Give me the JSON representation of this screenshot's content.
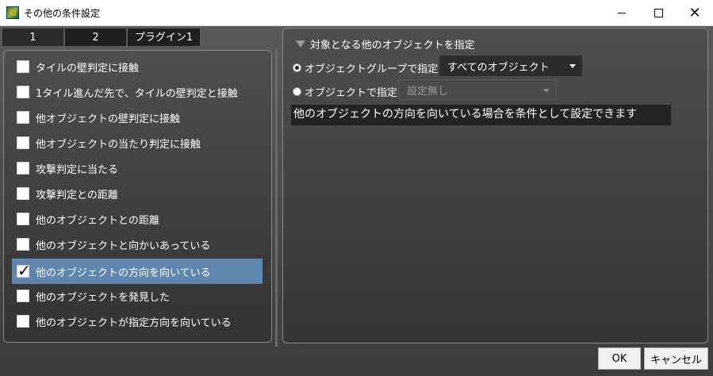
{
  "window": {
    "title": "その他の条件設定",
    "minimize": "",
    "maximize": "",
    "close": "✕"
  },
  "tabs": [
    "1",
    "2",
    "プラグイン1"
  ],
  "conditions": [
    {
      "label": "タイルの壁判定に接触",
      "checked": false
    },
    {
      "label": "1タイル進んだ先で、タイルの壁判定と接触",
      "checked": false
    },
    {
      "label": "他オブジェクトの壁判定に接触",
      "checked": false
    },
    {
      "label": "他オブジェクトの当たり判定に接触",
      "checked": false
    },
    {
      "label": "攻撃判定に当たる",
      "checked": false
    },
    {
      "label": "攻撃判定との距離",
      "checked": false
    },
    {
      "label": "他のオブジェクトとの距離",
      "checked": false
    },
    {
      "label": "他のオブジェクトと向かいあっている",
      "checked": false
    },
    {
      "label": "他のオブジェクトの方向を向いている",
      "checked": true,
      "selected": true
    },
    {
      "label": "他のオブジェクトを発見した",
      "checked": false
    },
    {
      "label": "他のオブジェクトが指定方向を向いている",
      "checked": false
    }
  ],
  "target": {
    "title": "対象となる他のオブジェクトを指定",
    "group_label": "オブジェクトグループで指定",
    "group_value": "すべてのオブジェクト",
    "object_label": "オブジェクトで指定",
    "object_value": "設定無し",
    "description": "他のオブジェクトの方向を向いている場合を条件として設定できます"
  },
  "buttons": {
    "ok": "OK",
    "cancel": "キャンセル"
  },
  "colors": {
    "selected_row": "#5f86ae",
    "panel_border": "#8a8a8a"
  }
}
